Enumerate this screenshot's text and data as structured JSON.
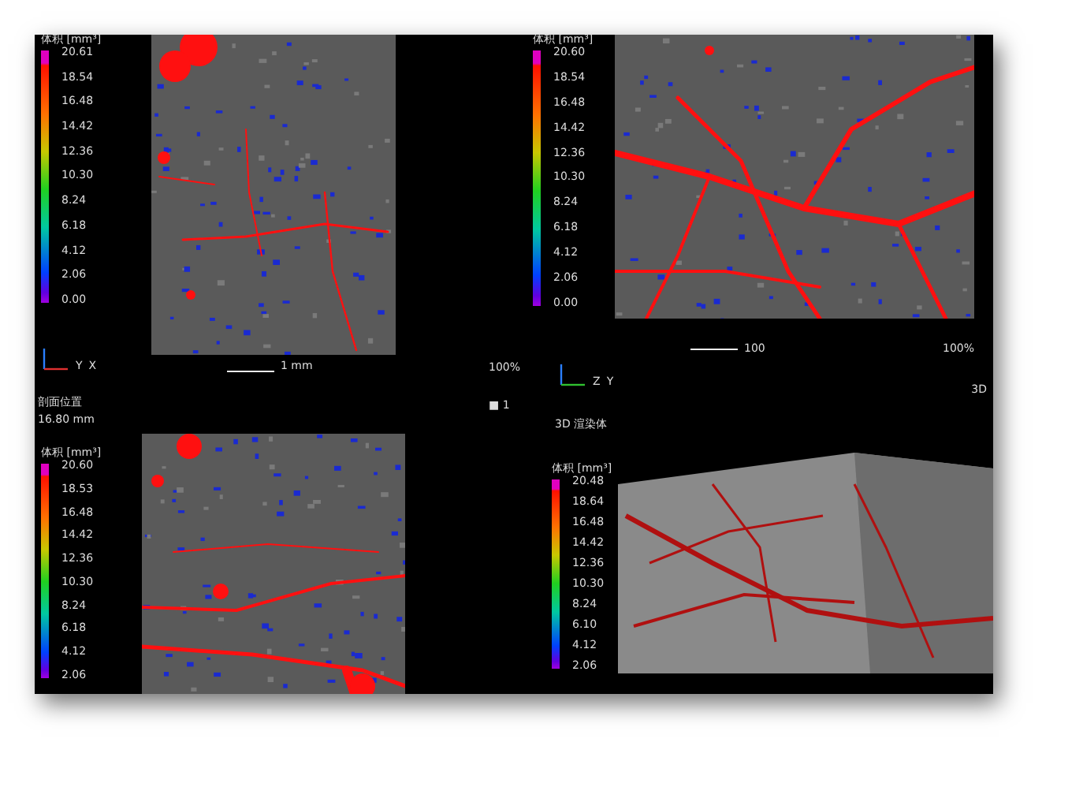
{
  "views": [
    {
      "kind": "slice",
      "legend": {
        "title": "体积 [mm³]",
        "ticks": [
          "20.61",
          "18.54",
          "16.48",
          "14.42",
          "12.36",
          "10.30",
          "8.24",
          "6.18",
          "4.12",
          "2.06",
          "0.00"
        ]
      },
      "axes": [
        "Y",
        "X"
      ],
      "scale_label": "1 mm",
      "caption": "剖面位置",
      "caption_value": "16.80 mm"
    },
    {
      "kind": "slice",
      "legend": {
        "title": "体积 [mm³]",
        "ticks": [
          "20.60",
          "18.54",
          "16.48",
          "14.42",
          "12.36",
          "10.30",
          "8.24",
          "6.18",
          "4.12",
          "2.06",
          "0.00"
        ]
      },
      "scale_label": "100",
      "zoom": "100%"
    },
    {
      "kind": "slice",
      "legend": {
        "title": "体积 [mm³]",
        "ticks": [
          "20.60",
          "18.53",
          "16.48",
          "14.42",
          "12.36",
          "10.30",
          "8.24",
          "6.18",
          "4.12",
          "2.06"
        ]
      }
    },
    {
      "kind": "volume",
      "legend": {
        "title": "体积 [mm³]",
        "ticks": [
          "20.48",
          "18.64",
          "16.48",
          "14.42",
          "12.36",
          "10.30",
          "8.24",
          "6.10",
          "4.12",
          "2.06"
        ]
      },
      "axes": [
        "Z",
        "Y"
      ],
      "zoom": "100%",
      "caption": "3D 渲染体",
      "marker": "■ 1",
      "mode": "3D"
    }
  ]
}
